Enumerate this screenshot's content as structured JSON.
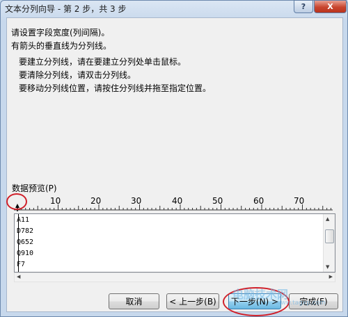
{
  "window": {
    "title": "文本分列向导 - 第 2 步，共 3 步",
    "help_glyph": "?",
    "close_glyph": "X"
  },
  "instructions": {
    "line1": "请设置字段宽度(列间隔)。",
    "line2": "有箭头的垂直线为分列线。",
    "tip1": "要建立分列线，请在要建立分列处单击鼠标。",
    "tip2": "要清除分列线，请双击分列线。",
    "tip3": "要移动分列线位置，请按住分列线并拖至指定位置。"
  },
  "preview": {
    "label": "数据预览(P)",
    "ruler_ticks": [
      "10",
      "20",
      "30",
      "40",
      "50",
      "60",
      "70"
    ],
    "rows": [
      "A11",
      "D782",
      "Q652",
      "Q910",
      "F7"
    ]
  },
  "buttons": {
    "cancel": "取消",
    "back": "< 上一步(B)",
    "next": "下一步(N) >",
    "finish": "完成(F)"
  },
  "watermark": {
    "main": "电脑技术网",
    "sub": "www.tagxp.com"
  },
  "colors": {
    "annotation_red": "#d0202a",
    "title_bar": "#c7d8ec",
    "close_button": "#c8452e"
  }
}
